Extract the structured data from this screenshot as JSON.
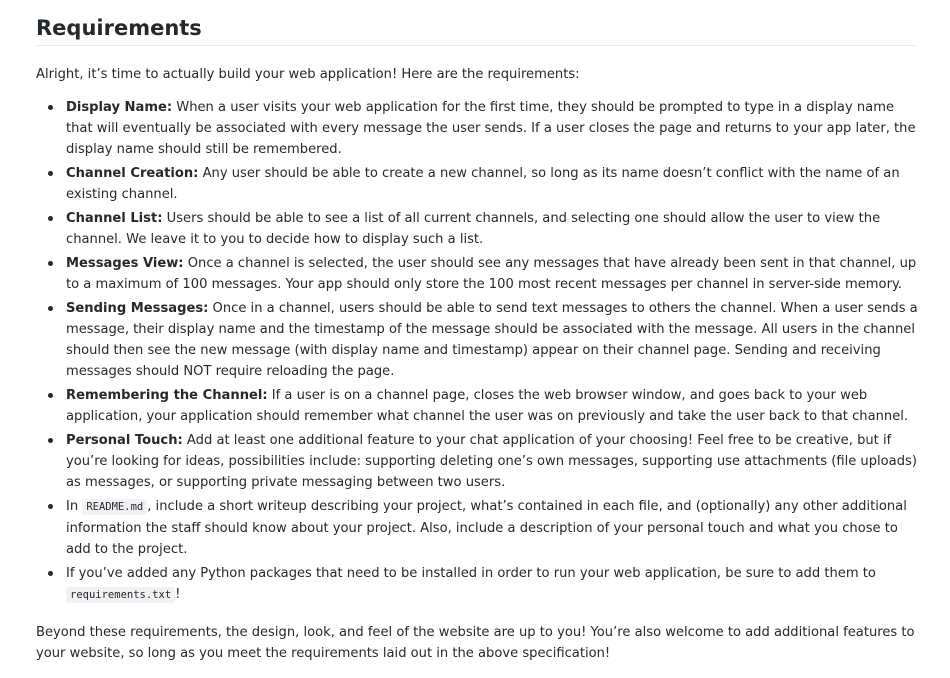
{
  "section": {
    "title": "Requirements",
    "intro": "Alright, it’s time to actually build your web application! Here are the requirements:"
  },
  "requirements": [
    {
      "term": "Display Name:",
      "text": " When a user visits your web application for the first time, they should be prompted to type in a display name that will eventually be associated with every message the user sends. If a user closes the page and returns to your app later, the display name should still be remembered."
    },
    {
      "term": "Channel Creation:",
      "text": " Any user should be able to create a new channel, so long as its name doesn’t conflict with the name of an existing channel."
    },
    {
      "term": "Channel List:",
      "text": " Users should be able to see a list of all current channels, and selecting one should allow the user to view the channel. We leave it to you to decide how to display such a list."
    },
    {
      "term": "Messages View:",
      "text": " Once a channel is selected, the user should see any messages that have already been sent in that channel, up to a maximum of 100 messages. Your app should only store the 100 most recent messages per channel in server-side memory."
    },
    {
      "term": "Sending Messages:",
      "text": " Once in a channel, users should be able to send text messages to others the channel. When a user sends a message, their display name and the timestamp of the message should be associated with the message. All users in the channel should then see the new message (with display name and timestamp) appear on their channel page. Sending and receiving messages should NOT require reloading the page."
    },
    {
      "term": "Remembering the Channel:",
      "text": " If a user is on a channel page, closes the web browser window, and goes back to your web application, your application should remember what channel the user was on previously and take the user back to that channel."
    },
    {
      "term": "Personal Touch:",
      "text": " Add at least one additional feature to your chat application of your choosing! Feel free to be creative, but if you’re looking for ideas, possibilities include: supporting deleting one’s own messages, supporting use attachments (file uploads) as messages, or supporting private messaging between two users."
    }
  ],
  "readme_item": {
    "before": "In ",
    "code": "README.md",
    "after": ", include a short writeup describing your project, what’s contained in each file, and (optionally) any other additional information the staff should know about your project. Also, include a description of your personal touch and what you chose to add to the project."
  },
  "packages_item": {
    "before": "If you’ve added any Python packages that need to be installed in order to run your web application, be sure to add them to ",
    "code": "requirements.txt",
    "after": "!"
  },
  "outro": "Beyond these requirements, the design, look, and feel of the website are up to you! You’re also welcome to add additional features to your website, so long as you meet the requirements laid out in the above specification!"
}
